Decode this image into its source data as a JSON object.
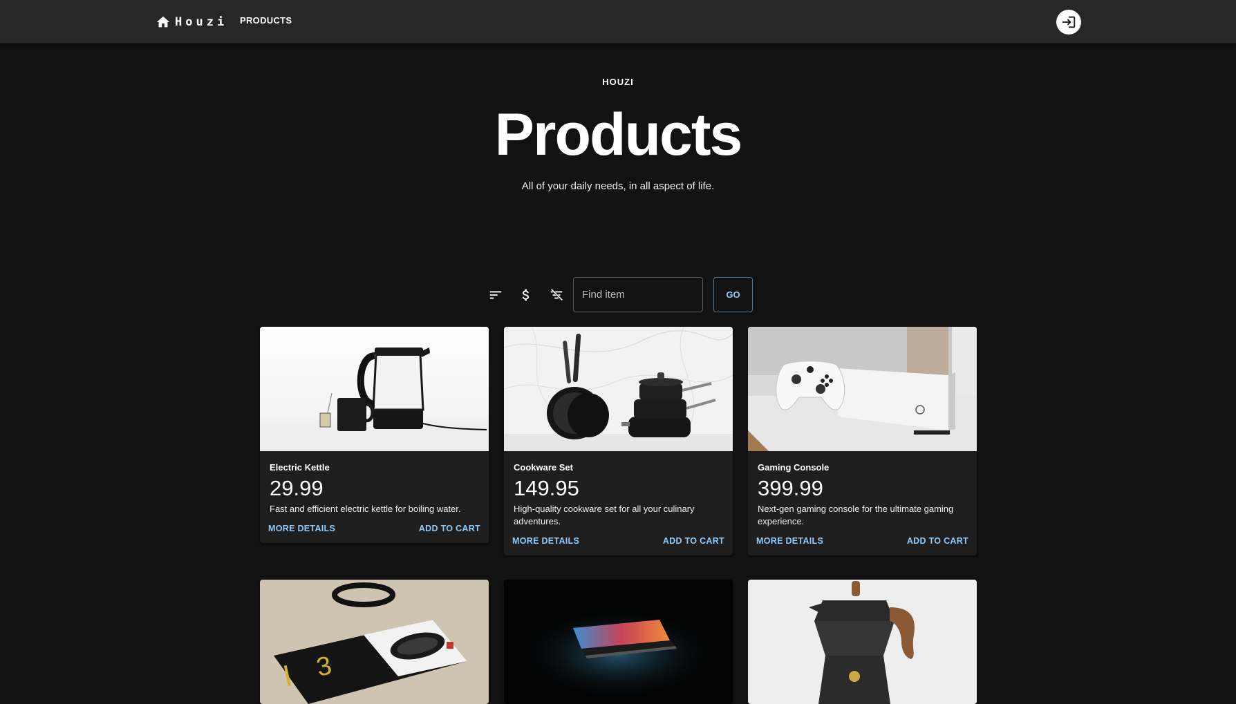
{
  "app": {
    "brand": "Houzi",
    "nav_products": "PRODUCTS"
  },
  "hero": {
    "overline": "HOUZI",
    "title": "Products",
    "subtitle": "All of your daily needs, in all aspect of life."
  },
  "toolbar": {
    "search_placeholder": "Find item",
    "go_label": "GO",
    "icons": [
      "sort-icon",
      "dollar-icon",
      "clear-filter-icon"
    ]
  },
  "products": [
    {
      "title": "Electric Kettle",
      "price": "29.99",
      "description": "Fast and efficient electric kettle for boiling water.",
      "details_label": "MORE DETAILS",
      "cart_label": "ADD TO CART"
    },
    {
      "title": "Cookware Set",
      "price": "149.95",
      "description": "High-quality cookware set for all your culinary adventures.",
      "details_label": "MORE DETAILS",
      "cart_label": "ADD TO CART"
    },
    {
      "title": "Gaming Console",
      "price": "399.99",
      "description": "Next-gen gaming console for the ultimate gaming experience.",
      "details_label": "MORE DETAILS",
      "cart_label": "ADD TO CART"
    }
  ],
  "colors": {
    "background": "#121212",
    "appbar": "#272727",
    "card": "#1e1e1e",
    "accent": "#90caf9"
  }
}
